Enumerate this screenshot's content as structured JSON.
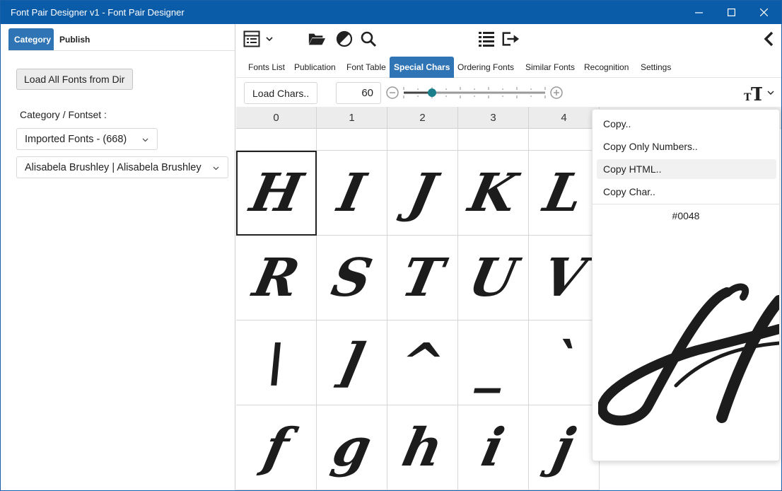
{
  "window": {
    "title": "Font Pair Designer v1 - Font Pair Designer",
    "titlebar_color": "#0b5ca8"
  },
  "left_panel": {
    "tabs": [
      {
        "label": "Category",
        "active": true
      },
      {
        "label": "Publish",
        "active": false
      }
    ],
    "load_button": "Load All Fonts from Dir",
    "category_label": "Category / Fontset :",
    "category_select": "Imported Fonts - (668)",
    "font_select": "Alisabela Brushley | Alisabela Brushley"
  },
  "toolbar": {
    "icons": [
      "list-view-icon",
      "chevron-down-icon",
      "folder-open-icon",
      "contrast-icon",
      "search-icon",
      "list-icon",
      "export-icon",
      "chevron-left-icon"
    ]
  },
  "tabs": [
    {
      "label": "Fonts List",
      "active": false
    },
    {
      "label": "Publication",
      "active": false
    },
    {
      "label": "Font Table",
      "active": false
    },
    {
      "label": "Special Chars",
      "active": true
    },
    {
      "label": "Ordering Fonts",
      "active": false
    },
    {
      "label": "Similar Fonts",
      "active": false
    },
    {
      "label": "Recognition",
      "active": false
    },
    {
      "label": "Settings",
      "active": false
    }
  ],
  "subbar": {
    "load_chars": "Load Chars..",
    "size_value": "60",
    "slider_value_fraction": 0.2,
    "accent_color": "#1a7f8a"
  },
  "grid": {
    "columns": [
      "0",
      "1",
      "2",
      "3",
      "4"
    ],
    "rows": [
      [
        "H",
        "I",
        "J",
        "K",
        "L"
      ],
      [
        "R",
        "S",
        "T",
        "U",
        "V"
      ],
      [
        "\\",
        "]",
        "^",
        "_",
        "`"
      ],
      [
        "f",
        "g",
        "h",
        "i",
        "j"
      ]
    ],
    "selected": {
      "row": 0,
      "col": 0
    }
  },
  "context_menu": {
    "items": [
      "Copy..",
      "Copy Only Numbers..",
      "Copy HTML..",
      "Copy Char.."
    ],
    "hovered_index": 2,
    "char_code": "#0048",
    "preview_char": "H"
  }
}
